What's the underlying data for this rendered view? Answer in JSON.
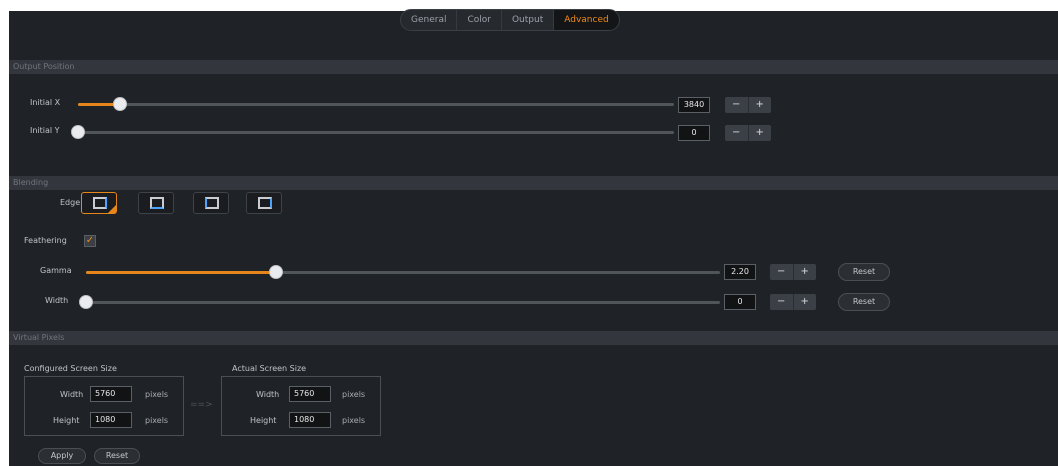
{
  "tabs": [
    {
      "label": "General",
      "active": false
    },
    {
      "label": "Color",
      "active": false
    },
    {
      "label": "Output",
      "active": false
    },
    {
      "label": "Advanced",
      "active": true
    }
  ],
  "output_position": {
    "title": "Output Position",
    "initial_x": {
      "label": "Initial X",
      "value": "3840",
      "fraction": 0.07
    },
    "initial_y": {
      "label": "Initial Y",
      "value": "0",
      "fraction": 0.0
    }
  },
  "blending": {
    "title": "Blending",
    "edge_label": "Edge",
    "edges": [
      "right",
      "bottom",
      "left",
      "right-alt"
    ],
    "selected_edge": 0,
    "feathering_label": "Feathering",
    "feathering_checked": true,
    "gamma": {
      "label": "Gamma",
      "value": "2.20",
      "fraction": 0.3
    },
    "width": {
      "label": "Width",
      "value": "0",
      "fraction": 0.0
    },
    "reset_label": "Reset"
  },
  "stepper": {
    "minus": "−",
    "plus": "+"
  },
  "virtual_pixels": {
    "title": "Virtual Pixels",
    "configured": {
      "title": "Configured Screen Size",
      "width_label": "Width",
      "width": "5760",
      "height_label": "Height",
      "height": "1080",
      "unit": "pixels"
    },
    "actual": {
      "title": "Actual Screen Size",
      "width_label": "Width",
      "width": "5760",
      "height_label": "Height",
      "height": "1080",
      "unit": "pixels"
    },
    "arrow": "==>",
    "apply_label": "Apply",
    "reset_label": "Reset"
  },
  "colors": {
    "accent": "#e6861b",
    "panel": "#1f2226",
    "section": "#33373d"
  }
}
